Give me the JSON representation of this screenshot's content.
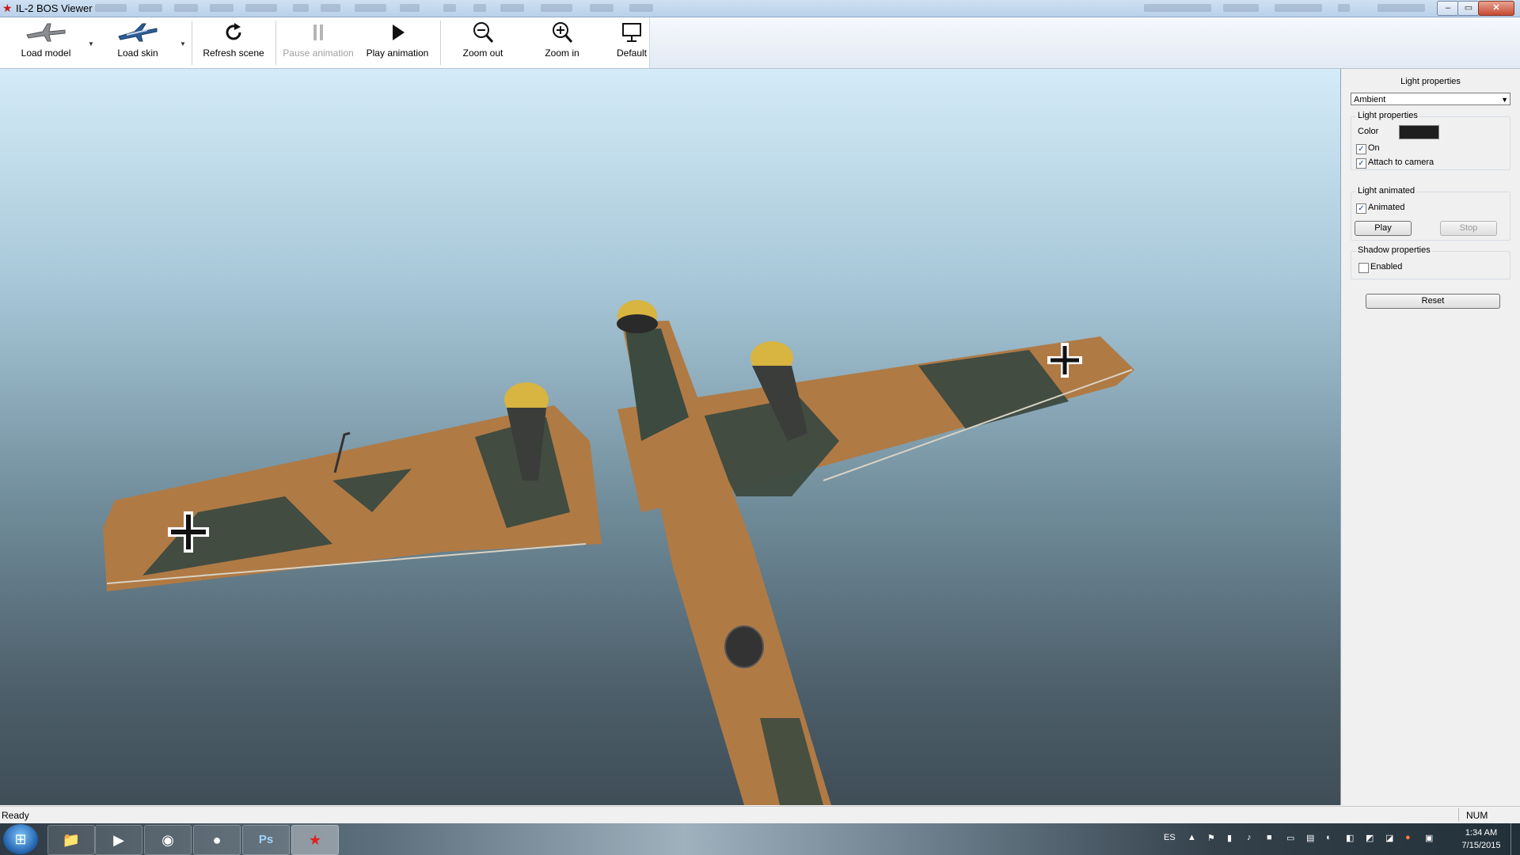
{
  "window": {
    "title": "IL-2 BOS Viewer",
    "controls": {
      "minimize": "‒",
      "maximize": "▭",
      "close": "✕"
    }
  },
  "toolbar": {
    "load_model": "Load model",
    "load_skin": "Load skin",
    "refresh_scene": "Refresh scene",
    "pause_animation": "Pause animation",
    "play_animation": "Play animation",
    "zoom_out": "Zoom out",
    "zoom_in": "Zoom in",
    "default": "Default"
  },
  "panel": {
    "header": "Light properties",
    "light_type": "Ambient",
    "light_group": {
      "label": "Light properties",
      "color_label": "Color",
      "color_value": "#1e1e1e",
      "on_label": "On",
      "on_checked": true,
      "attach_label": "Attach to camera",
      "attach_checked": true
    },
    "animated_group": {
      "label": "Light animated",
      "animated_label": "Animated",
      "animated_checked": true,
      "play_label": "Play",
      "stop_label": "Stop"
    },
    "shadow_group": {
      "label": "Shadow properties",
      "enabled_label": "Enabled",
      "enabled_checked": false
    },
    "reset_label": "Reset"
  },
  "statusbar": {
    "status": "Ready",
    "num": "NUM"
  },
  "taskbar": {
    "language": "ES",
    "time": "1:34 AM",
    "date": "7/15/2015",
    "apps": [
      "windows-explorer",
      "media-player",
      "chrome",
      "origin",
      "photoshop",
      "il2-viewer"
    ]
  },
  "colors": {
    "sky_top": "#d4ebf8",
    "sky_bottom": "#3f4d57",
    "camo_tan": "#b07a45",
    "camo_green": "#3c4a40",
    "spinner_yellow": "#d8b441"
  }
}
